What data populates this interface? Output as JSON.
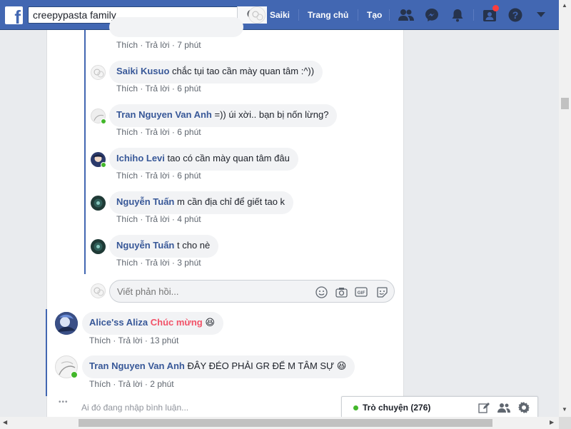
{
  "topbar": {
    "search_value": "creepypasta family",
    "profile_name": "Saiki",
    "home_label": "Trang chủ",
    "create_label": "Tạo",
    "brand_color": "#4267b2"
  },
  "comments": [
    {
      "name": "",
      "text": "",
      "time": "7 phút"
    },
    {
      "name": "Saiki Kusuo",
      "text": "chắc tụi tao cần mày quan tâm :^))",
      "time": "6 phút"
    },
    {
      "name": "Tran Nguyen Van Anh",
      "text": "=)) úi xời.. bạn bị nốn lừng?",
      "time": "6 phút"
    },
    {
      "name": "Ichiho Levi",
      "text": "tao có cần mày quan tâm đâu",
      "time": "6 phút"
    },
    {
      "name": "Nguyễn Tuấn",
      "text": "m cần địa chỉ để giết tao k",
      "time": "4 phút"
    },
    {
      "name": "Nguyễn Tuấn",
      "text": "t cho nè",
      "time": "3 phút"
    }
  ],
  "reply_box": {
    "placeholder": "Viết phản hồi..."
  },
  "top_comments": [
    {
      "name": "Alice'ss Aliza",
      "highlight": "Chúc mừng",
      "highlight_color": "#f25268",
      "emoji": "😆",
      "time": "13 phút"
    },
    {
      "name": "Tran Nguyen Van Anh",
      "text": "ĐÂY ĐÉO PHẢI GR ĐỂ M TÂM SỰ",
      "emoji": "😆",
      "time": "2 phút"
    }
  ],
  "actions": {
    "like": "Thích",
    "reply": "Trả lời",
    "sep": " · "
  },
  "typing_indicator": {
    "dots": "•••",
    "text": "Ai đó đang nhập bình luận..."
  },
  "chat": {
    "label": "Trò chuyện (276)"
  }
}
